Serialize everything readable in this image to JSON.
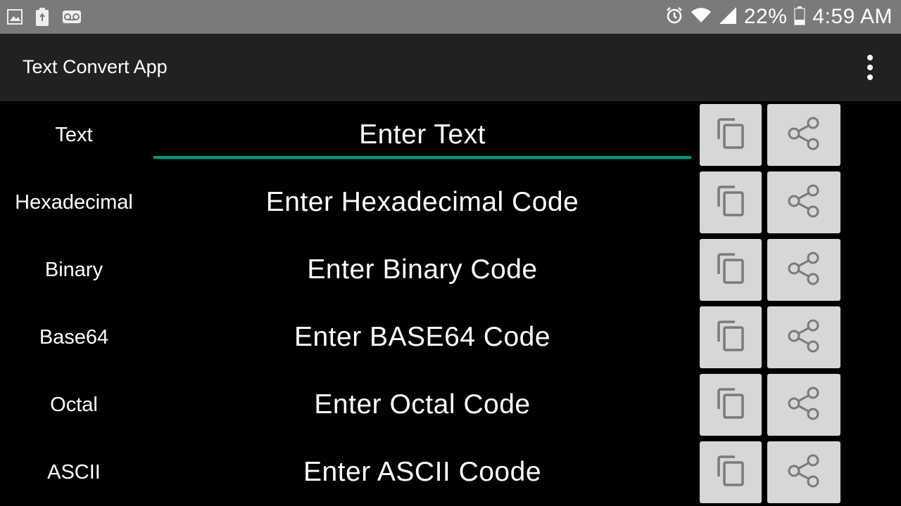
{
  "status_bar": {
    "left_icons": [
      "image-icon",
      "battery-saver-icon",
      "voicemail-icon"
    ],
    "right_icons": [
      "alarm-icon",
      "wifi-icon",
      "signal-icon",
      "battery-icon"
    ],
    "battery_percent": "22%",
    "time": "4:59 AM"
  },
  "app_bar": {
    "title": "Text Convert App",
    "menu_icon": "more-vert-icon"
  },
  "rows": [
    {
      "label": "Text",
      "placeholder": "Enter Text",
      "focused": true,
      "copy_icon": "copy-icon",
      "share_icon": "share-icon"
    },
    {
      "label": "Hexadecimal",
      "placeholder": "Enter Hexadecimal Code",
      "focused": false,
      "copy_icon": "copy-icon",
      "share_icon": "share-icon"
    },
    {
      "label": "Binary",
      "placeholder": "Enter Binary Code",
      "focused": false,
      "copy_icon": "copy-icon",
      "share_icon": "share-icon"
    },
    {
      "label": "Base64",
      "placeholder": "Enter BASE64 Code",
      "focused": false,
      "copy_icon": "copy-icon",
      "share_icon": "share-icon"
    },
    {
      "label": "Octal",
      "placeholder": "Enter Octal Code",
      "focused": false,
      "copy_icon": "copy-icon",
      "share_icon": "share-icon"
    },
    {
      "label": "ASCII",
      "placeholder": "Enter ASCII Coode",
      "focused": false,
      "copy_icon": "copy-icon",
      "share_icon": "share-icon"
    }
  ],
  "colors": {
    "status_bar_bg": "#7a7a7a",
    "app_bar_bg": "#212121",
    "background": "#000000",
    "accent": "#009688",
    "button_bg": "#d6d7d6",
    "icon_gray": "#7a7a7a"
  }
}
